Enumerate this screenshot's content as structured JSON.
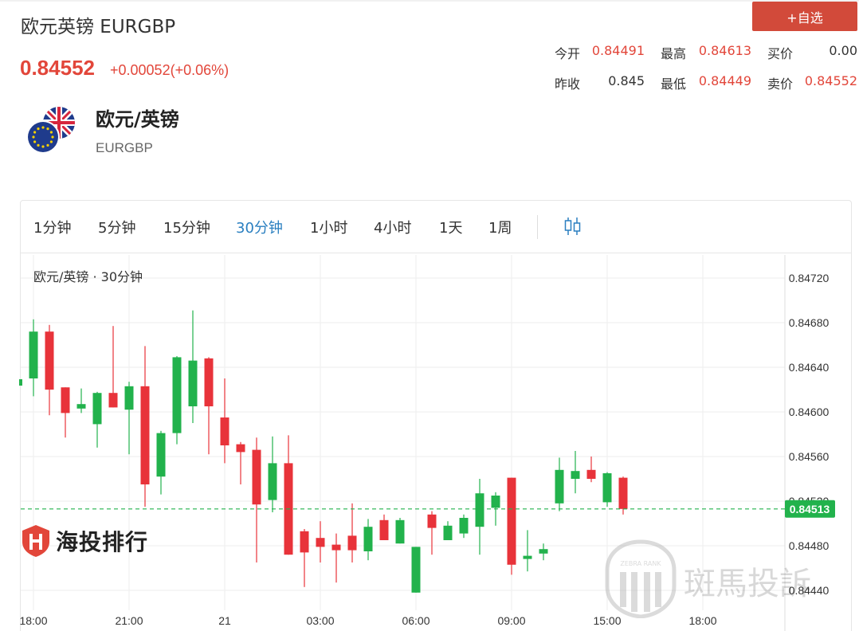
{
  "header": {
    "title": "欧元英镑 EURGBP",
    "add_button": "+自选",
    "price": "0.84552",
    "change": "+0.00052(+0.06%)"
  },
  "quotes": {
    "open_label": "今开",
    "open": "0.84491",
    "high_label": "最高",
    "high": "0.84613",
    "bid_label": "买价",
    "bid": "0.00",
    "prev_close_label": "昨收",
    "prev_close": "0.845",
    "low_label": "最低",
    "low": "0.84449",
    "ask_label": "卖价",
    "ask": "0.84552"
  },
  "instrument": {
    "name": "欧元/英镑",
    "code": "EURGBP"
  },
  "tabs": [
    "1分钟",
    "5分钟",
    "15分钟",
    "30分钟",
    "1小时",
    "4小时",
    "1天",
    "1周"
  ],
  "active_tab": "30分钟",
  "watermarks": {
    "left": "海投排行",
    "right": "斑馬投訴",
    "badge": "ZEBRA RANK"
  },
  "colors": {
    "up": "#22b24c",
    "down": "#e8333a",
    "accent_red": "#e2463a",
    "active_tab": "#2a7fc0",
    "current_price_line": "#22b24c"
  },
  "chart_data": {
    "type": "candlestick",
    "title": "欧元/英镑 · 30分钟",
    "x_tick_labels": [
      "18:00",
      "21:00",
      "21",
      "03:00",
      "06:00",
      "09:00",
      "15:00",
      "18:00"
    ],
    "y_tick_labels": [
      "0.84720",
      "0.84680",
      "0.84640",
      "0.84600",
      "0.84560",
      "0.84520",
      "0.84480",
      "0.84440"
    ],
    "ylim": [
      0.8443,
      0.8473
    ],
    "current_price": "0.84513",
    "grid": true,
    "candles": [
      {
        "o": 0.8463,
        "c": 0.84672,
        "h": 0.84683,
        "l": 0.84614
      },
      {
        "o": 0.84672,
        "c": 0.8462,
        "h": 0.84678,
        "l": 0.84597
      },
      {
        "o": 0.84622,
        "c": 0.84599,
        "h": 0.84622,
        "l": 0.84577
      },
      {
        "o": 0.84603,
        "c": 0.84607,
        "h": 0.84621,
        "l": 0.84599
      },
      {
        "o": 0.84589,
        "c": 0.84617,
        "h": 0.84618,
        "l": 0.84568
      },
      {
        "o": 0.84617,
        "c": 0.84604,
        "h": 0.84677,
        "l": 0.84604
      },
      {
        "o": 0.84602,
        "c": 0.84623,
        "h": 0.84627,
        "l": 0.84562
      },
      {
        "o": 0.84623,
        "c": 0.84535,
        "h": 0.84659,
        "l": 0.84515
      },
      {
        "o": 0.84542,
        "c": 0.84581,
        "h": 0.84583,
        "l": 0.84526
      },
      {
        "o": 0.84581,
        "c": 0.84649,
        "h": 0.8465,
        "l": 0.84571
      },
      {
        "o": 0.84605,
        "c": 0.84646,
        "h": 0.84691,
        "l": 0.8459
      },
      {
        "o": 0.84648,
        "c": 0.84605,
        "h": 0.84649,
        "l": 0.84562
      },
      {
        "o": 0.84595,
        "c": 0.8457,
        "h": 0.8463,
        "l": 0.84554
      },
      {
        "o": 0.84571,
        "c": 0.84564,
        "h": 0.84573,
        "l": 0.84535
      },
      {
        "o": 0.84566,
        "c": 0.84517,
        "h": 0.84577,
        "l": 0.84465
      },
      {
        "o": 0.84521,
        "c": 0.84554,
        "h": 0.84578,
        "l": 0.8451
      },
      {
        "o": 0.84554,
        "c": 0.84472,
        "h": 0.84579,
        "l": 0.84472
      },
      {
        "o": 0.84493,
        "c": 0.84474,
        "h": 0.84495,
        "l": 0.84443
      },
      {
        "o": 0.84487,
        "c": 0.84479,
        "h": 0.84502,
        "l": 0.84465
      },
      {
        "o": 0.84481,
        "c": 0.84476,
        "h": 0.84491,
        "l": 0.84447
      },
      {
        "o": 0.84489,
        "c": 0.84476,
        "h": 0.84518,
        "l": 0.84465
      },
      {
        "o": 0.84475,
        "c": 0.84497,
        "h": 0.84504,
        "l": 0.84467
      },
      {
        "o": 0.84503,
        "c": 0.84485,
        "h": 0.84508,
        "l": 0.84485
      },
      {
        "o": 0.84482,
        "c": 0.84503,
        "h": 0.84505,
        "l": 0.84482
      },
      {
        "o": 0.84438,
        "c": 0.84479,
        "h": 0.84479,
        "l": 0.84438
      },
      {
        "o": 0.84508,
        "c": 0.84496,
        "h": 0.84511,
        "l": 0.84472
      },
      {
        "o": 0.84485,
        "c": 0.84498,
        "h": 0.84502,
        "l": 0.84485
      },
      {
        "o": 0.84491,
        "c": 0.84505,
        "h": 0.84508,
        "l": 0.84487
      },
      {
        "o": 0.84497,
        "c": 0.84527,
        "h": 0.8454,
        "l": 0.84472
      },
      {
        "o": 0.84514,
        "c": 0.84525,
        "h": 0.84528,
        "l": 0.84498
      },
      {
        "o": 0.84541,
        "c": 0.84463,
        "h": 0.84541,
        "l": 0.84454
      },
      {
        "o": 0.8447,
        "c": 0.84471,
        "h": 0.84494,
        "l": 0.84457
      },
      {
        "o": 0.84473,
        "c": 0.84477,
        "h": 0.84482,
        "l": 0.84467
      },
      {
        "o": 0.84518,
        "c": 0.84548,
        "h": 0.84559,
        "l": 0.84511
      },
      {
        "o": 0.8454,
        "c": 0.84547,
        "h": 0.84565,
        "l": 0.84527
      },
      {
        "o": 0.84548,
        "c": 0.8454,
        "h": 0.8456,
        "l": 0.84537
      },
      {
        "o": 0.84519,
        "c": 0.84545,
        "h": 0.84546,
        "l": 0.84515
      },
      {
        "o": 0.84541,
        "c": 0.84513,
        "h": 0.84542,
        "l": 0.84508
      }
    ]
  }
}
